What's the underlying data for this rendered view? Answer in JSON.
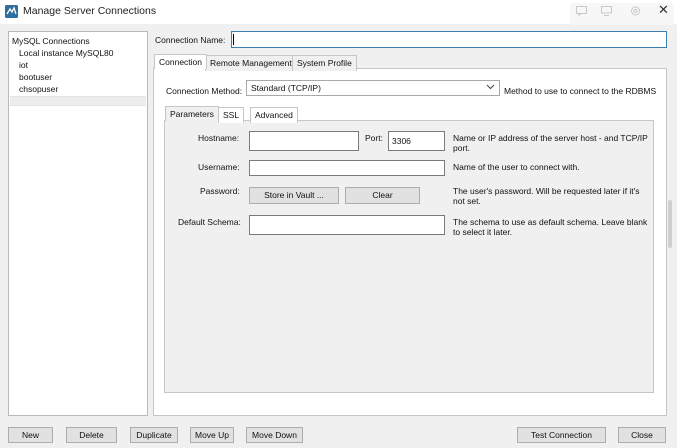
{
  "window": {
    "title": "Manage Server Connections"
  },
  "sidebar": {
    "header": "MySQL Connections",
    "items": [
      "Local instance MySQL80",
      "iot",
      "bootuser",
      "chsopuser"
    ]
  },
  "form": {
    "connection_name_label": "Connection Name:",
    "connection_name_value": ""
  },
  "tabs": [
    "Connection",
    "Remote Management",
    "System Profile"
  ],
  "connection": {
    "method_label": "Connection Method:",
    "method_value": "Standard (TCP/IP)",
    "method_desc": "Method to use to connect to the RDBMS"
  },
  "subtabs": [
    "Parameters",
    "SSL",
    "Advanced"
  ],
  "params": {
    "hostname_label": "Hostname:",
    "hostname_value": "",
    "port_label": "Port:",
    "port_value": "3306",
    "hostname_desc": "Name or IP address of the server host - and TCP/IP port.",
    "username_label": "Username:",
    "username_value": "",
    "username_desc": "Name of the user to connect with.",
    "password_label": "Password:",
    "store_vault_label": "Store in Vault ...",
    "clear_label": "Clear",
    "password_desc": "The user's password. Will be requested later if it's not set.",
    "schema_label": "Default Schema:",
    "schema_value": "",
    "schema_desc": "The schema to use as default schema. Leave blank to select it later."
  },
  "footer": {
    "new_label": "New",
    "delete_label": "Delete",
    "duplicate_label": "Duplicate",
    "move_up_label": "Move Up",
    "move_down_label": "Move Down",
    "test_label": "Test Connection",
    "close_label": "Close"
  },
  "colors": {
    "accent": "#3c7fb1",
    "icon_blue": "#2f6fa0"
  },
  "icons": [
    "mysql-workbench-icon",
    "chat-icon",
    "monitor-icon",
    "settings-icon",
    "close-icon",
    "chevron-down-icon"
  ]
}
